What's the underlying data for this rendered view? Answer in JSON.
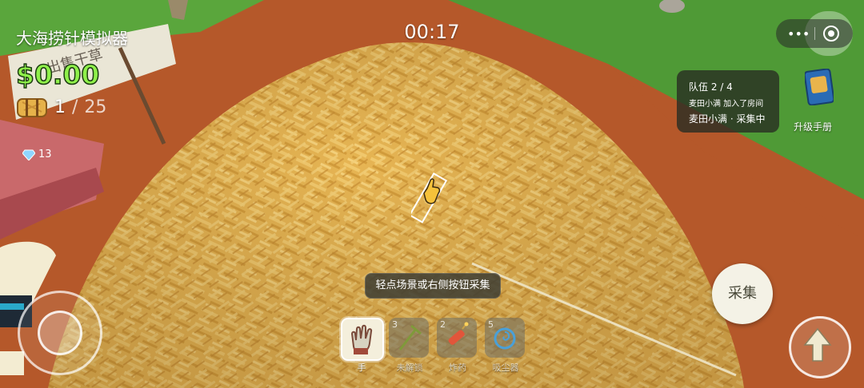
{
  "game": {
    "title": "大海捞针模拟器",
    "timer": "00:17",
    "money": "$0.00",
    "hay": {
      "current": "1",
      "separator": "/",
      "capacity": "25"
    },
    "gems": "13",
    "sign_text": "出售干草"
  },
  "team_panel": {
    "line1": "队伍 2 / 4",
    "line2": "麦田小满 加入了房间",
    "line3": "麦田小满 · 采集中"
  },
  "upgrade_book": {
    "label": "升级手册"
  },
  "hint": "轻点场景或右侧按钮采集",
  "hotbar": [
    {
      "label": "手",
      "icon": "glove-icon",
      "number": "",
      "active": true
    },
    {
      "label": "未解锁",
      "icon": "rake-icon",
      "number": "3",
      "active": false
    },
    {
      "label": "炸药",
      "icon": "dynamite-icon",
      "number": "2",
      "active": false
    },
    {
      "label": "吸尘器",
      "icon": "vacuum-icon",
      "number": "5",
      "active": false
    }
  ],
  "buttons": {
    "collect": "采集",
    "jump_icon": "arrow-up-icon"
  },
  "colors": {
    "money": "#8ff04a",
    "hay": "#e6b24a",
    "ground": "#b5582a",
    "grass": "#4f9a36"
  }
}
